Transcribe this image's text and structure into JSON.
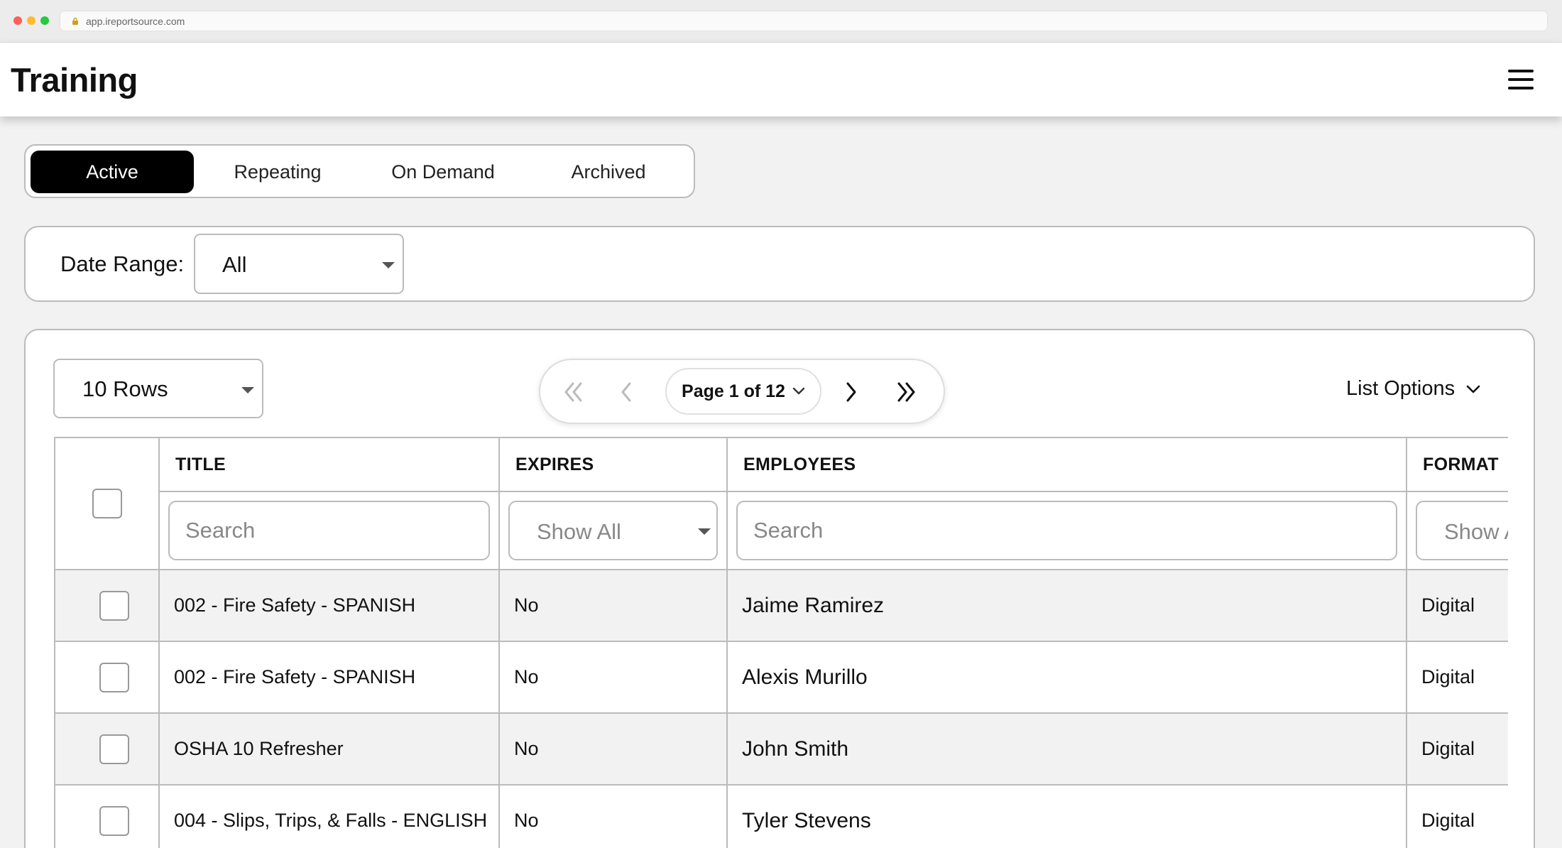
{
  "browser": {
    "url": "app.ireportsource.com"
  },
  "header": {
    "title": "Training"
  },
  "tabs": [
    {
      "label": "Active",
      "active": true
    },
    {
      "label": "Repeating",
      "active": false
    },
    {
      "label": "On Demand",
      "active": false
    },
    {
      "label": "Archived",
      "active": false
    }
  ],
  "filters": {
    "date_range_label": "Date Range:",
    "date_range_value": "All"
  },
  "list": {
    "rows_select": "10 Rows",
    "pager": {
      "page_label": "Page 1 of 12",
      "current_page": 1,
      "total_pages": 12
    },
    "list_options_label": "List Options"
  },
  "table": {
    "columns": [
      "TITLE",
      "EXPIRES",
      "EMPLOYEES",
      "FORMAT"
    ],
    "filters": {
      "title_placeholder": "Search",
      "expires_value": "Show All",
      "employees_placeholder": "Search",
      "format_value": "Show All"
    },
    "rows": [
      {
        "title": "002 - Fire Safety - SPANISH",
        "expires": "No",
        "employees": "Jaime Ramirez",
        "format": "Digital"
      },
      {
        "title": "002 - Fire Safety - SPANISH",
        "expires": "No",
        "employees": "Alexis Murillo",
        "format": "Digital"
      },
      {
        "title": "OSHA 10 Refresher",
        "expires": "No",
        "employees": "John Smith",
        "format": "Digital"
      },
      {
        "title": "004 - Slips, Trips, & Falls - ENGLISH",
        "expires": "No",
        "employees": "Tyler Stevens",
        "format": "Digital"
      }
    ]
  },
  "colors": {
    "active_tab_bg": "#000000",
    "border": "#bbbbbb",
    "page_bg": "#f2f2f2"
  }
}
